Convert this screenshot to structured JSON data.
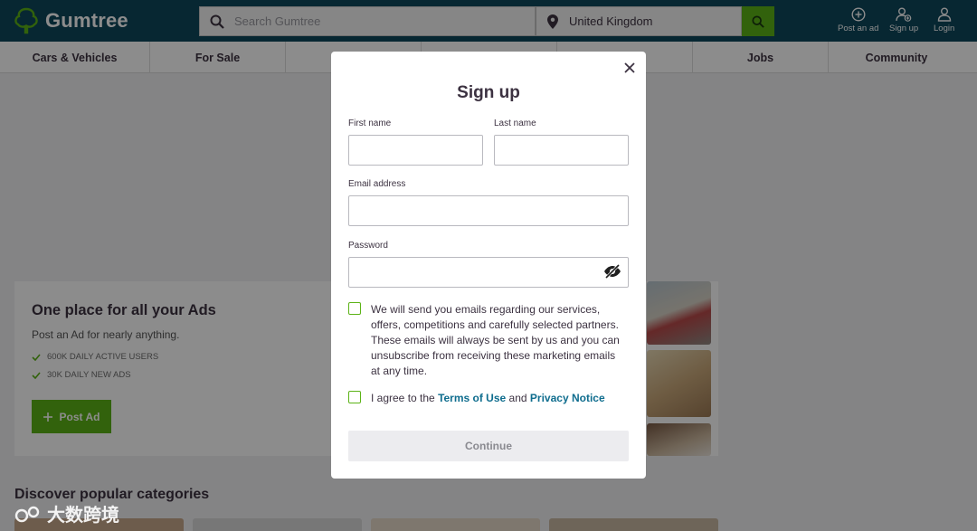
{
  "header": {
    "brand": "Gumtree",
    "search_placeholder": "Search Gumtree",
    "location": "United Kingdom",
    "actions": [
      {
        "label": "Post an ad",
        "icon": "plus-circle-icon"
      },
      {
        "label": "Sign up",
        "icon": "user-add-icon"
      },
      {
        "label": "Login",
        "icon": "user-icon"
      }
    ]
  },
  "categories": [
    "Cars & Vehicles",
    "For Sale",
    "",
    "",
    "",
    "Jobs",
    "Community"
  ],
  "promo": {
    "title": "One place for all your Ads",
    "subtitle": "Post an Ad for nearly anything.",
    "stats": [
      "600K DAILY ACTIVE USERS",
      "30K DAILY NEW ADS"
    ],
    "button": "Post Ad"
  },
  "popular_title": "Discover popular categories",
  "modal": {
    "title": "Sign up",
    "first_name_label": "First name",
    "last_name_label": "Last name",
    "email_label": "Email address",
    "password_label": "Password",
    "consent_text": "We will send you emails regarding our services, offers, competitions and carefully selected partners. These emails will always be sent by us and you can unsubscribe from receiving these marketing emails at any time.",
    "agree_prefix": "I agree to the",
    "terms": "Terms of Use",
    "agree_and": "and",
    "privacy": "Privacy Notice",
    "continue": "Continue"
  },
  "watermark": "大数跨境",
  "colors": {
    "header_bg": "#0d475c",
    "brand_green": "#5cb317",
    "link": "#0f6d8e"
  }
}
